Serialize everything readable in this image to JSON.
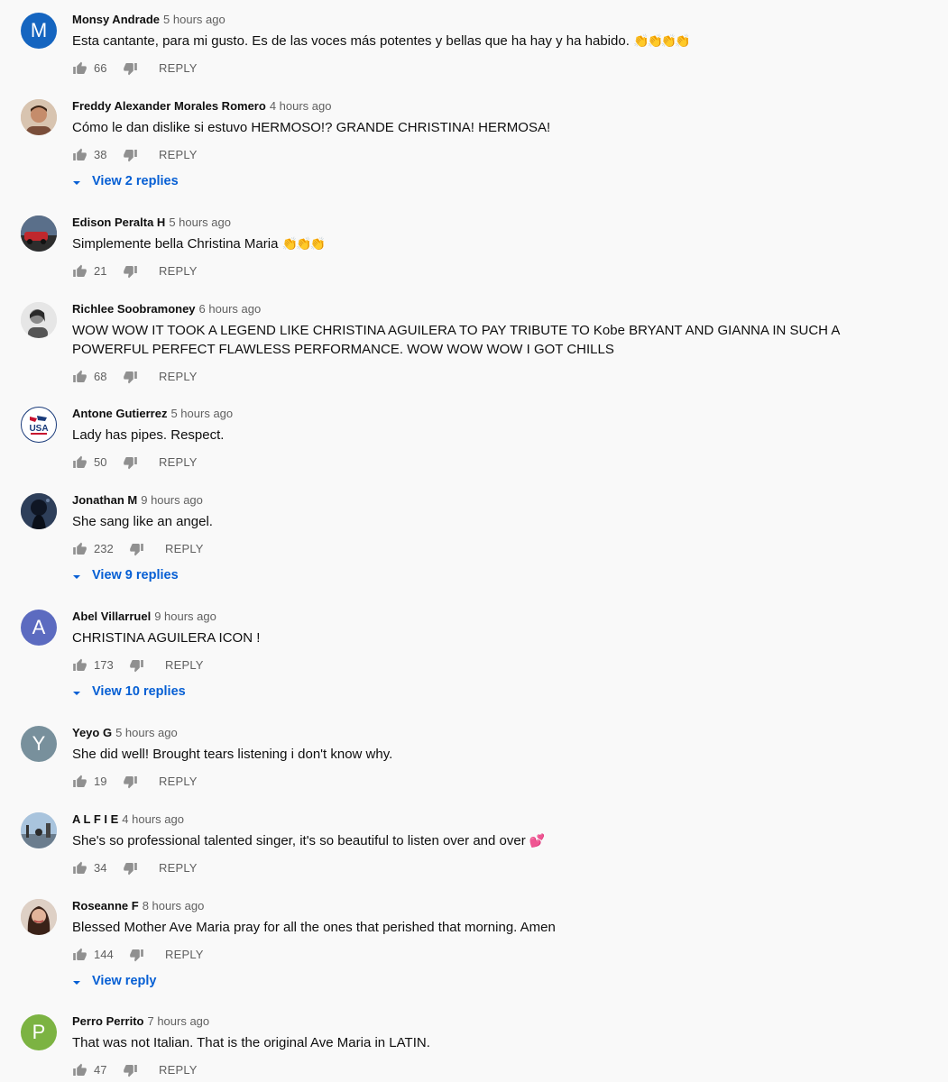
{
  "comments": [
    {
      "author": "Monsy Andrade",
      "time": "5 hours ago",
      "text": "Esta cantante, para mi gusto. Es de las voces más potentes y bellas que ha hay y ha habido.",
      "emoji": "👏👏👏👏",
      "likes": "66",
      "reply_label": "REPLY",
      "avatar_letter": "M",
      "avatar_color": "#1565c0"
    },
    {
      "author": "Freddy Alexander Morales Romero",
      "time": "4 hours ago",
      "text": "Cómo le dan dislike si estuvo HERMOSO!? GRANDE CHRISTINA! HERMOSA!",
      "likes": "38",
      "reply_label": "REPLY",
      "view_replies": "View 2 replies"
    },
    {
      "author": "Edison Peralta H",
      "time": "5 hours ago",
      "text": "Simplemente bella Christina  Maria",
      "emoji": "👏👏👏",
      "likes": "21",
      "reply_label": "REPLY"
    },
    {
      "author": "Richlee Soobramoney",
      "time": "6 hours ago",
      "text": "WOW WOW IT TOOK A LEGEND LIKE CHRISTINA AGUILERA TO PAY TRIBUTE TO Kobe BRYANT AND GIANNA IN SUCH A POWERFUL PERFECT FLAWLESS PERFORMANCE. WOW WOW WOW I GOT CHILLS",
      "likes": "68",
      "reply_label": "REPLY"
    },
    {
      "author": "Antone Gutierrez",
      "time": "5 hours ago",
      "text": "Lady has pipes.  Respect.",
      "likes": "50",
      "reply_label": "REPLY",
      "avatar_text": "USA"
    },
    {
      "author": "Jonathan M",
      "time": "9 hours ago",
      "text": "She sang like an angel.",
      "likes": "232",
      "reply_label": "REPLY",
      "view_replies": "View 9 replies"
    },
    {
      "author": "Abel Villarruel",
      "time": "9 hours ago",
      "text": "CHRISTINA AGUILERA ICON !",
      "likes": "173",
      "reply_label": "REPLY",
      "view_replies": "View 10 replies",
      "avatar_letter": "A",
      "avatar_color": "#5c6bc0"
    },
    {
      "author": "Yeyo G",
      "time": "5 hours ago",
      "text": "She did well! Brought tears listening i don't know why.",
      "likes": "19",
      "reply_label": "REPLY",
      "avatar_letter": "Y",
      "avatar_color": "#78909c"
    },
    {
      "author": "A L F I E",
      "time": "4 hours ago",
      "text": "She's so professional talented singer, it's so beautiful to listen over and over",
      "emoji": "💕",
      "likes": "34",
      "reply_label": "REPLY"
    },
    {
      "author": "Roseanne F",
      "time": "8 hours ago",
      "text": "Blessed Mother Ave Maria pray for all the ones that perished that morning. Amen",
      "likes": "144",
      "reply_label": "REPLY",
      "view_replies": "View reply"
    },
    {
      "author": "Perro Perrito",
      "time": "7 hours ago",
      "text": "That was not Italian.  That is the original Ave Maria in LATIN.",
      "likes": "47",
      "reply_label": "REPLY",
      "avatar_letter": "P",
      "avatar_color": "#7cb342"
    }
  ],
  "colors": {
    "link": "#065fd4",
    "meta": "#606060",
    "background": "#f9f9f9"
  }
}
